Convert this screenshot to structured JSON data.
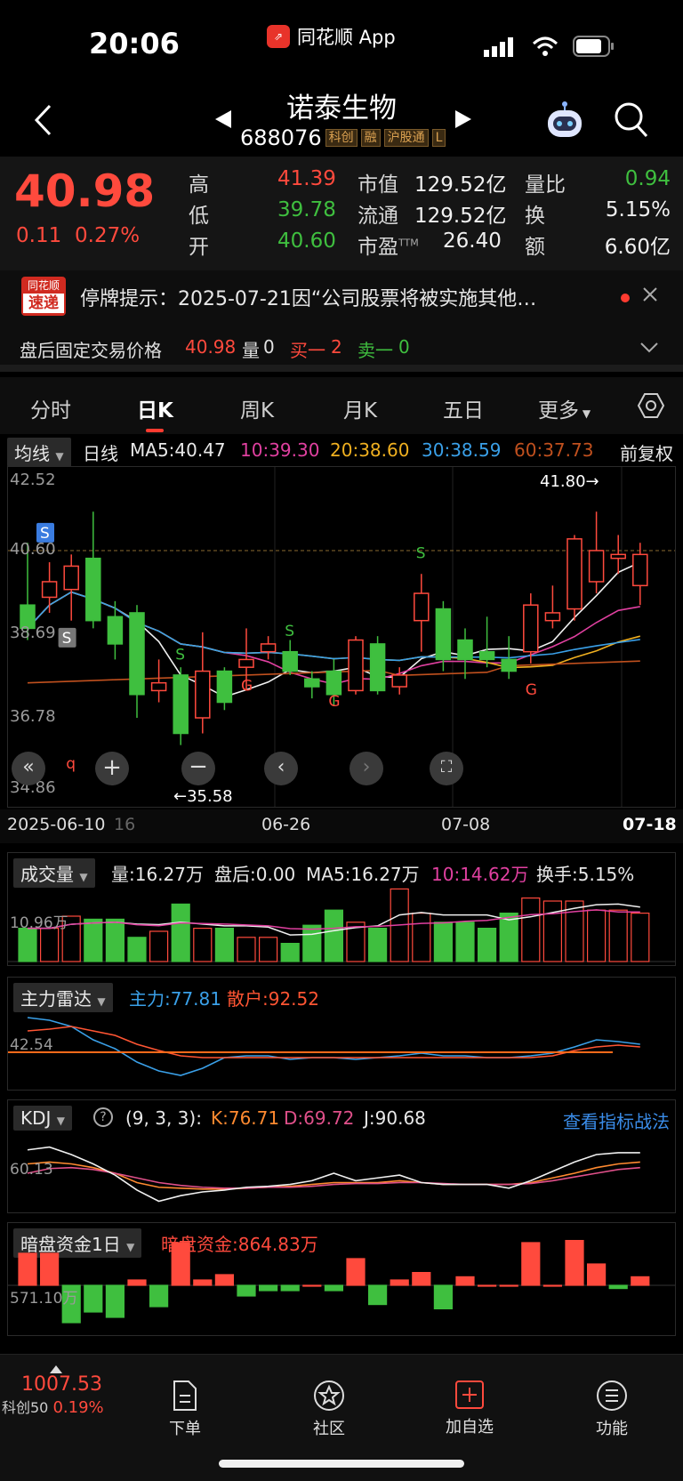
{
  "status_bar": {
    "time": "20:06",
    "app_name": "同花顺 App"
  },
  "header": {
    "title": "诺泰生物",
    "code": "688076",
    "tags": [
      "科创",
      "融",
      "沪股通",
      "L"
    ]
  },
  "quote": {
    "price": "40.98",
    "change": "0.11",
    "change_pct": "0.27%",
    "high_label": "高",
    "high": "41.39",
    "low_label": "低",
    "low": "39.78",
    "open_label": "开",
    "open": "40.60",
    "mktcap_label": "市值",
    "mktcap": "129.52亿",
    "float_label": "流通",
    "float": "129.52亿",
    "pe_label": "市盈",
    "pe_sup": "TTM",
    "pe": "26.40",
    "volratio_label": "量比",
    "volratio": "0.94",
    "turnover_label": "换",
    "turnover": "5.15%",
    "amount_label": "额",
    "amount": "6.60亿"
  },
  "notice": {
    "brand_top": "同花顺",
    "brand_bottom": "速递",
    "text": "停牌提示：2025-07-21因“公司股票将被实施其他…"
  },
  "after_hours": {
    "label": "盘后固定交易价格",
    "price": "40.98",
    "vol_label": "量",
    "vol": "0",
    "buy_label": "买一",
    "buy": "2",
    "sell_label": "卖一",
    "sell": "0"
  },
  "tabs": [
    "分时",
    "日K",
    "周K",
    "月K",
    "五日",
    "更多"
  ],
  "ma_bar": {
    "selector": "均线",
    "period": "日线",
    "ma5": "MA5:40.47",
    "ma10": "10:39.30",
    "ma20": "20:38.60",
    "ma30": "30:38.59",
    "ma60": "60:37.73",
    "adjust": "前复权"
  },
  "colors": {
    "up": "#ff4a3d",
    "down": "#3fbf3f",
    "ma5": "#f0f0f0",
    "ma10": "#e040a0",
    "ma20": "#f0b020",
    "ma30": "#3aa0e8",
    "ma60": "#c0501e"
  },
  "chart_data": [
    {
      "type": "candlestick",
      "y_ticks": [
        "42.52",
        "40.60",
        "38.69",
        "36.78",
        "34.86"
      ],
      "ylim": [
        34.86,
        42.52
      ],
      "x_labels": [
        "2025-06-10",
        "16",
        "06-26",
        "07-08",
        "07-18"
      ],
      "high_marker": "41.80→",
      "low_marker": "←35.58",
      "signals": [
        "S",
        "S",
        "S",
        "S",
        "S",
        "G",
        "G",
        "G",
        "q"
      ],
      "candles": [
        {
          "o": 39.2,
          "c": 38.6,
          "h": 40.8,
          "l": 38.3
        },
        {
          "o": 39.4,
          "c": 39.8,
          "h": 40.3,
          "l": 39.0
        },
        {
          "o": 39.6,
          "c": 40.2,
          "h": 40.5,
          "l": 38.8
        },
        {
          "o": 40.4,
          "c": 38.8,
          "h": 41.6,
          "l": 38.6
        },
        {
          "o": 38.9,
          "c": 38.2,
          "h": 39.3,
          "l": 37.8
        },
        {
          "o": 39.0,
          "c": 36.9,
          "h": 39.2,
          "l": 36.3
        },
        {
          "o": 37.0,
          "c": 37.2,
          "h": 37.8,
          "l": 36.7
        },
        {
          "o": 37.4,
          "c": 35.9,
          "h": 37.6,
          "l": 35.6
        },
        {
          "o": 36.3,
          "c": 37.5,
          "h": 38.5,
          "l": 35.9
        },
        {
          "o": 37.5,
          "c": 36.7,
          "h": 37.6,
          "l": 36.5
        },
        {
          "o": 37.6,
          "c": 37.8,
          "h": 38.6,
          "l": 37.0
        },
        {
          "o": 38.0,
          "c": 38.2,
          "h": 38.4,
          "l": 37.8
        },
        {
          "o": 38.0,
          "c": 37.5,
          "h": 38.3,
          "l": 37.4
        },
        {
          "o": 37.3,
          "c": 37.1,
          "h": 37.5,
          "l": 36.8
        },
        {
          "o": 37.5,
          "c": 36.9,
          "h": 37.8,
          "l": 36.6
        },
        {
          "o": 37.0,
          "c": 38.3,
          "h": 38.4,
          "l": 36.9
        },
        {
          "o": 38.2,
          "c": 37.0,
          "h": 38.4,
          "l": 36.9
        },
        {
          "o": 37.1,
          "c": 37.4,
          "h": 37.6,
          "l": 36.9
        },
        {
          "o": 38.8,
          "c": 39.5,
          "h": 40.0,
          "l": 38.0
        },
        {
          "o": 39.1,
          "c": 37.8,
          "h": 39.3,
          "l": 37.5
        },
        {
          "o": 38.3,
          "c": 37.8,
          "h": 38.6,
          "l": 37.3
        },
        {
          "o": 38.0,
          "c": 37.8,
          "h": 38.9,
          "l": 37.6
        },
        {
          "o": 37.8,
          "c": 37.5,
          "h": 38.4,
          "l": 37.3
        },
        {
          "o": 38.0,
          "c": 39.2,
          "h": 39.5,
          "l": 37.7
        },
        {
          "o": 38.8,
          "c": 39.0,
          "h": 39.7,
          "l": 38.6
        },
        {
          "o": 39.1,
          "c": 40.9,
          "h": 41.0,
          "l": 38.8
        },
        {
          "o": 39.8,
          "c": 40.6,
          "h": 41.6,
          "l": 39.5
        },
        {
          "o": 40.4,
          "c": 40.5,
          "h": 41.0,
          "l": 40.0
        },
        {
          "o": 39.7,
          "c": 40.5,
          "h": 40.8,
          "l": 39.2
        }
      ]
    },
    {
      "type": "bar",
      "name": "成交量",
      "summary": [
        "量:16.27万",
        "盘后:0.00",
        "MA5:16.27万",
        "10:14.62万",
        "换手:5.15%"
      ],
      "y_tick": "10.96万",
      "values": [
        11,
        11,
        15,
        14,
        14,
        8,
        10,
        19,
        11,
        11,
        8,
        8,
        6,
        12,
        17,
        13,
        11,
        24,
        16,
        13,
        13,
        11,
        16,
        21,
        20,
        20,
        17,
        17,
        16
      ]
    },
    {
      "type": "line",
      "name": "主力雷达",
      "summary": [
        "主力:77.81",
        "散户:92.52"
      ],
      "y_tick": "42.54",
      "series": [
        {
          "name": "主力",
          "values": [
            95,
            92,
            85,
            70,
            60,
            45,
            35,
            30,
            38,
            50,
            52,
            52,
            48,
            50,
            50,
            48,
            50,
            52,
            55,
            52,
            52,
            50,
            50,
            52,
            55,
            62,
            70,
            68,
            65
          ]
        },
        {
          "name": "散户",
          "values": [
            80,
            82,
            85,
            80,
            75,
            65,
            58,
            52,
            50,
            50,
            50,
            50,
            50,
            50,
            50,
            50,
            50,
            50,
            50,
            50,
            50,
            50,
            50,
            50,
            52,
            58,
            62,
            64,
            62
          ]
        }
      ]
    },
    {
      "type": "line",
      "name": "KDJ",
      "params": "(9, 3, 3):",
      "summary": [
        "K:76.71",
        "D:69.72",
        "J:90.68"
      ],
      "y_tick": "60.13",
      "link": "查看指标战法",
      "series": [
        {
          "name": "K",
          "values": [
            70,
            72,
            70,
            66,
            60,
            50,
            45,
            44,
            43,
            43,
            44,
            45,
            46,
            48,
            50,
            50,
            50,
            52,
            50,
            48,
            48,
            48,
            48,
            50,
            55,
            60,
            66,
            70,
            72
          ]
        },
        {
          "name": "D",
          "values": [
            60,
            65,
            66,
            64,
            60,
            55,
            50,
            47,
            45,
            44,
            44,
            45,
            45,
            46,
            48,
            49,
            49,
            50,
            50,
            49,
            48,
            48,
            48,
            49,
            52,
            56,
            60,
            64,
            66
          ]
        },
        {
          "name": "J",
          "values": [
            85,
            88,
            80,
            70,
            58,
            42,
            30,
            36,
            40,
            42,
            45,
            46,
            48,
            52,
            60,
            52,
            55,
            58,
            50,
            48,
            48,
            48,
            44,
            52,
            62,
            72,
            80,
            82,
            82
          ]
        }
      ]
    },
    {
      "type": "bar",
      "name": "暗盘资金1日",
      "summary": [
        "暗盘资金:864.83万"
      ],
      "y_tick": "571.10万",
      "values": [
        30,
        30,
        -35,
        -25,
        -30,
        5,
        -20,
        40,
        5,
        10,
        -10,
        -5,
        -5,
        0,
        -5,
        25,
        -18,
        5,
        12,
        -22,
        8,
        0,
        0,
        40,
        0,
        42,
        20,
        -3,
        8
      ]
    }
  ],
  "bottom_nav": {
    "index_value": "1007.53",
    "index_name": "科创50",
    "index_pct": "0.19%",
    "items": [
      "下单",
      "社区",
      "加自选",
      "功能"
    ]
  }
}
